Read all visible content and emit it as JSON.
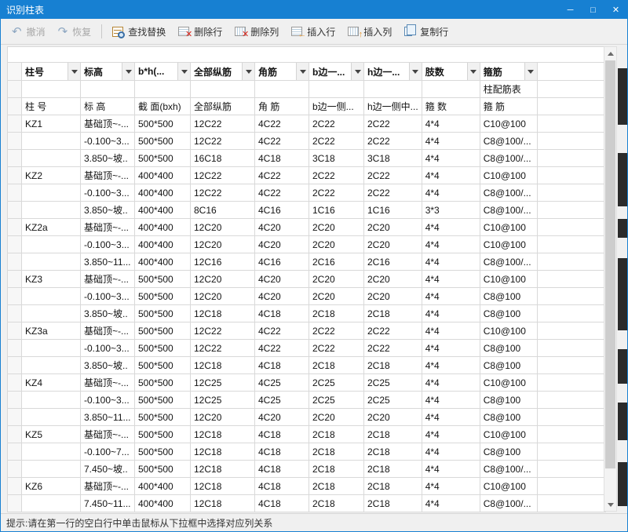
{
  "window": {
    "title": "识别柱表",
    "controls": {
      "minimize": "─",
      "maximize": "□",
      "close": "✕"
    }
  },
  "toolbar": {
    "separator_after": 1,
    "buttons": [
      {
        "label": "撤消",
        "icon": "undo-icon",
        "disabled": true
      },
      {
        "label": "恢复",
        "icon": "redo-icon",
        "disabled": true
      },
      {
        "label": "查找替换",
        "icon": "find-replace-icon",
        "disabled": false
      },
      {
        "label": "删除行",
        "icon": "delete-row-icon",
        "disabled": false
      },
      {
        "label": "删除列",
        "icon": "delete-column-icon",
        "disabled": false
      },
      {
        "label": "插入行",
        "icon": "insert-row-icon",
        "disabled": false
      },
      {
        "label": "插入列",
        "icon": "insert-column-icon",
        "disabled": false
      },
      {
        "label": "复制行",
        "icon": "copy-row-icon",
        "disabled": false
      }
    ]
  },
  "grid": {
    "combo_headers": [
      "柱号",
      "标高",
      "b*h(...",
      "全部纵筋",
      "角筋",
      "b边一...",
      "h边一...",
      "肢数",
      "箍筋"
    ],
    "title_row": {
      "text": "柱配筋表",
      "column_index": 8
    },
    "sub_headers": [
      "柱 号",
      "标 高",
      "截 面(bxh)",
      "全部纵筋",
      "角 筋",
      "b边一侧...",
      "h边一侧中...",
      "箍 数",
      "箍 筋"
    ],
    "rows": [
      [
        "KZ1",
        "基础顶~-...",
        "500*500",
        "12C22",
        "4C22",
        "2C22",
        "2C22",
        "4*4",
        "C10@100"
      ],
      [
        "",
        "-0.100~3...",
        "500*500",
        "12C22",
        "4C22",
        "2C22",
        "2C22",
        "4*4",
        "C8@100/..."
      ],
      [
        "",
        "3.850~坡..",
        "500*500",
        "16C18",
        "4C18",
        "3C18",
        "3C18",
        "4*4",
        "C8@100/..."
      ],
      [
        "KZ2",
        "基础顶~-...",
        "400*400",
        "12C22",
        "4C22",
        "2C22",
        "2C22",
        "4*4",
        "C10@100"
      ],
      [
        "",
        "-0.100~3...",
        "400*400",
        "12C22",
        "4C22",
        "2C22",
        "2C22",
        "4*4",
        "C8@100/..."
      ],
      [
        "",
        "3.850~坡..",
        "400*400",
        "8C16",
        "4C16",
        "1C16",
        "1C16",
        "3*3",
        "C8@100/..."
      ],
      [
        "KZ2a",
        "基础顶~-...",
        "400*400",
        "12C20",
        "4C20",
        "2C20",
        "2C20",
        "4*4",
        "C10@100"
      ],
      [
        "",
        "-0.100~3...",
        "400*400",
        "12C20",
        "4C20",
        "2C20",
        "2C20",
        "4*4",
        "C10@100"
      ],
      [
        "",
        "3.850~11...",
        "400*400",
        "12C16",
        "4C16",
        "2C16",
        "2C16",
        "4*4",
        "C8@100/..."
      ],
      [
        "KZ3",
        "基础顶~-...",
        "500*500",
        "12C20",
        "4C20",
        "2C20",
        "2C20",
        "4*4",
        "C10@100"
      ],
      [
        "",
        "-0.100~3...",
        "500*500",
        "12C20",
        "4C20",
        "2C20",
        "2C20",
        "4*4",
        "C8@100"
      ],
      [
        "",
        "3.850~坡..",
        "500*500",
        "12C18",
        "4C18",
        "2C18",
        "2C18",
        "4*4",
        "C8@100"
      ],
      [
        "KZ3a",
        "基础顶~-...",
        "500*500",
        "12C22",
        "4C22",
        "2C22",
        "2C22",
        "4*4",
        "C10@100"
      ],
      [
        "",
        "-0.100~3...",
        "500*500",
        "12C22",
        "4C22",
        "2C22",
        "2C22",
        "4*4",
        "C8@100"
      ],
      [
        "",
        "3.850~坡..",
        "500*500",
        "12C18",
        "4C18",
        "2C18",
        "2C18",
        "4*4",
        "C8@100"
      ],
      [
        "KZ4",
        "基础顶~-...",
        "500*500",
        "12C25",
        "4C25",
        "2C25",
        "2C25",
        "4*4",
        "C10@100"
      ],
      [
        "",
        "-0.100~3...",
        "500*500",
        "12C25",
        "4C25",
        "2C25",
        "2C25",
        "4*4",
        "C8@100"
      ],
      [
        "",
        "3.850~11...",
        "500*500",
        "12C20",
        "4C20",
        "2C20",
        "2C20",
        "4*4",
        "C8@100"
      ],
      [
        "KZ5",
        "基础顶~-...",
        "500*500",
        "12C18",
        "4C18",
        "2C18",
        "2C18",
        "4*4",
        "C10@100"
      ],
      [
        "",
        "-0.100~7...",
        "500*500",
        "12C18",
        "4C18",
        "2C18",
        "2C18",
        "4*4",
        "C8@100"
      ],
      [
        "",
        "7.450~坡..",
        "500*500",
        "12C18",
        "4C18",
        "2C18",
        "2C18",
        "4*4",
        "C8@100/..."
      ],
      [
        "KZ6",
        "基础顶~-...",
        "400*400",
        "12C18",
        "4C18",
        "2C18",
        "2C18",
        "4*4",
        "C10@100"
      ],
      [
        "",
        "7.450~11...",
        "400*400",
        "12C18",
        "4C18",
        "2C18",
        "2C18",
        "4*4",
        "C8@100/..."
      ]
    ]
  },
  "status_bar": {
    "text": "提示:请在第一行的空白行中单击鼠标从下拉框中选择对应列关系"
  },
  "colors": {
    "titlebar": "#1780d2",
    "delete_accent": "#d9261c",
    "insert_accent": "#e8962e"
  }
}
